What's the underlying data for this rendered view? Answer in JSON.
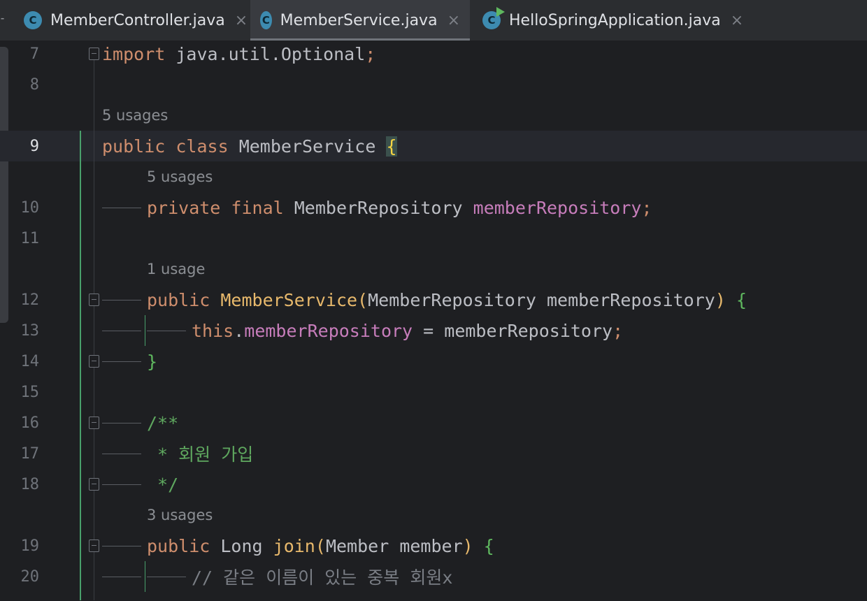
{
  "tabs": [
    {
      "label": "MemberController.java",
      "icon": "java-class-icon",
      "icon_letter": "C",
      "close": "×"
    },
    {
      "label": "MemberService.java",
      "icon": "java-class-icon",
      "icon_letter": "C",
      "close": "×"
    },
    {
      "label": "HelloSpringApplication.java",
      "icon": "java-run-class-icon",
      "icon_letter": "C",
      "close": "×"
    }
  ],
  "colors": {
    "keyword": "#cf8e6d",
    "function": "#e8b96c",
    "field": "#c77dbb",
    "comment": "#5fa85f",
    "background": "#1e1f22"
  },
  "editor": {
    "lines": {
      "l7": {
        "num": "7",
        "kw": "import",
        "rest": " java.util.Optional",
        "semi": ";"
      },
      "l8": {
        "num": "8"
      },
      "u1": {
        "text": "5 usages"
      },
      "l9": {
        "num": "9",
        "kw1": "public",
        "kw2": "class",
        "name": "MemberService",
        "brace": "{"
      },
      "u2": {
        "text": "5 usages"
      },
      "l10": {
        "num": "10",
        "kw1": "private",
        "kw2": "final",
        "type": "MemberRepository",
        "field": "memberRepository",
        "semi": ";"
      },
      "l11": {
        "num": "11"
      },
      "u3": {
        "text": "1 usage"
      },
      "l12": {
        "num": "12",
        "kw": "public",
        "fn": "MemberService",
        "open": "(",
        "ptype": "MemberRepository",
        "pname": "memberRepository",
        "close": ")",
        "brace": "{"
      },
      "l13": {
        "num": "13",
        "kw": "this",
        "dot": ".",
        "field": "memberRepository",
        "eq": " = ",
        "val": "memberRepository",
        "semi": ";"
      },
      "l14": {
        "num": "14",
        "brace": "}"
      },
      "l15": {
        "num": "15"
      },
      "l16": {
        "num": "16",
        "text": "/**"
      },
      "l17": {
        "num": "17",
        "text": " * 회원 가입"
      },
      "l18": {
        "num": "18",
        "text": " */"
      },
      "u4": {
        "text": "3 usages"
      },
      "l19": {
        "num": "19",
        "kw": "public",
        "type": "Long",
        "fn": "join",
        "open": "(",
        "ptype": "Member",
        "pname": "member",
        "close": ")",
        "brace": "{"
      },
      "l20": {
        "num": "20",
        "text": "// 같은 이름이 있는 중복 회원x"
      }
    }
  }
}
